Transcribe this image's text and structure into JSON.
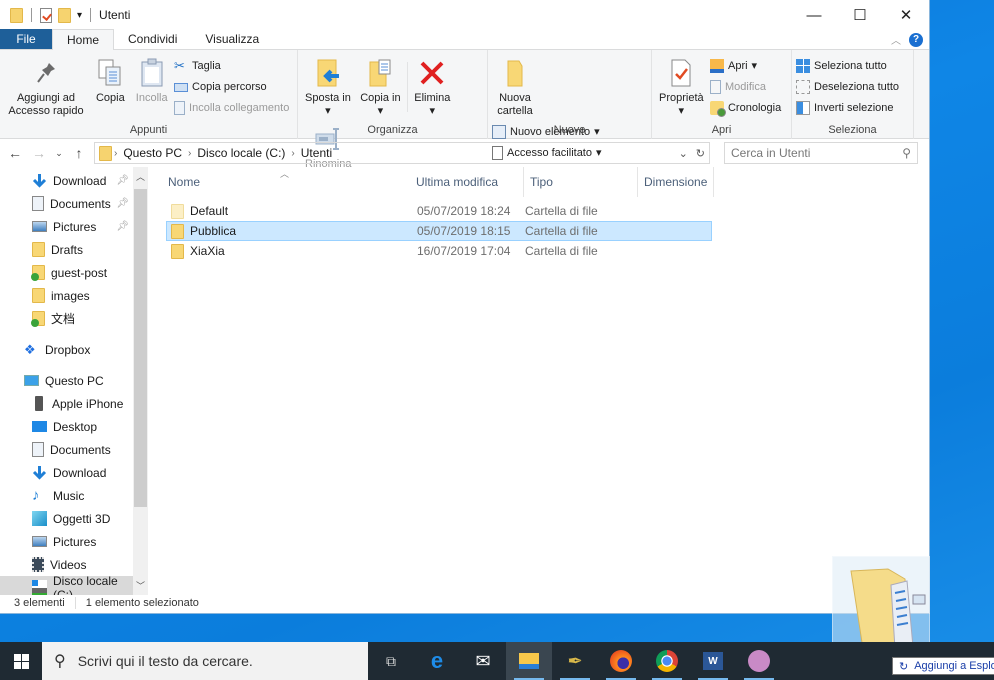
{
  "window": {
    "title": "Utenti",
    "controls": {
      "minimize": "—",
      "maximize": "☐",
      "close": "✕"
    }
  },
  "ribbon_tabs": [
    {
      "label": "File"
    },
    {
      "label": "Home",
      "active": true
    },
    {
      "label": "Condividi"
    },
    {
      "label": "Visualizza"
    }
  ],
  "ribbon": {
    "appunti": {
      "label": "Appunti",
      "pin": "Aggiungi ad Accesso rapido",
      "copia": "Copia",
      "incolla": "Incolla",
      "taglia": "Taglia",
      "copia_percorso": "Copia percorso",
      "incolla_collegamento": "Incolla collegamento"
    },
    "organizza": {
      "label": "Organizza",
      "sposta": "Sposta in",
      "copia_in": "Copia in",
      "elimina": "Elimina",
      "rinomina": "Rinomina"
    },
    "nuovo": {
      "label": "Nuovo",
      "nuova_cartella": "Nuova cartella",
      "nuovo_elemento": "Nuovo elemento",
      "accesso_facilitato": "Accesso facilitato"
    },
    "apri": {
      "label": "Apri",
      "proprieta": "Proprietà",
      "apri": "Apri",
      "modifica": "Modifica",
      "cronologia": "Cronologia"
    },
    "seleziona": {
      "label": "Seleziona",
      "seleziona_tutto": "Seleziona tutto",
      "deseleziona_tutto": "Deseleziona tutto",
      "inverti_selezione": "Inverti selezione"
    }
  },
  "address": {
    "crumbs": [
      "Questo PC",
      "Disco locale (C:)",
      "Utenti"
    ],
    "search_placeholder": "Cerca in Utenti"
  },
  "sidebar": {
    "quick_access": [
      {
        "label": "Download",
        "icon": "download",
        "pinned": true
      },
      {
        "label": "Documents",
        "icon": "documents",
        "pinned": true
      },
      {
        "label": "Pictures",
        "icon": "pictures",
        "pinned": true
      },
      {
        "label": "Drafts",
        "icon": "folder"
      },
      {
        "label": "guest-post",
        "icon": "folder-synced"
      },
      {
        "label": "images",
        "icon": "folder"
      },
      {
        "label": "文档",
        "icon": "folder-shared"
      }
    ],
    "dropbox": "Dropbox",
    "this_pc": "Questo PC",
    "pc_items": [
      {
        "label": "Apple iPhone",
        "icon": "phone"
      },
      {
        "label": "Desktop",
        "icon": "desktop"
      },
      {
        "label": "Documents",
        "icon": "documents"
      },
      {
        "label": "Download",
        "icon": "download"
      },
      {
        "label": "Music",
        "icon": "music"
      },
      {
        "label": "Oggetti 3D",
        "icon": "3d-objects"
      },
      {
        "label": "Pictures",
        "icon": "pictures"
      },
      {
        "label": "Videos",
        "icon": "videos"
      },
      {
        "label": "Disco locale (C:)",
        "icon": "drive",
        "selected": true
      }
    ]
  },
  "columns": {
    "name": "Nome",
    "date": "Ultima modifica",
    "type": "Tipo",
    "size": "Dimensione"
  },
  "files": [
    {
      "name": "Default",
      "date": "05/07/2019 18:24",
      "type": "Cartella di file",
      "size": ""
    },
    {
      "name": "Pubblica",
      "date": "05/07/2019 18:15",
      "type": "Cartella di file",
      "size": "",
      "selected": true
    },
    {
      "name": "XiaXia",
      "date": "16/07/2019 17:04",
      "type": "Cartella di file",
      "size": ""
    }
  ],
  "status": {
    "count": "3 elementi",
    "selection": "1 elemento selezionato"
  },
  "taskbar": {
    "search_placeholder": "Scrivi qui il testo da cercare.",
    "apps": [
      "task-view",
      "edge",
      "mail",
      "file-explorer",
      "pen-app",
      "firefox",
      "chrome",
      "word",
      "media-app"
    ]
  },
  "tooltip": "Aggiungi a Esplora"
}
